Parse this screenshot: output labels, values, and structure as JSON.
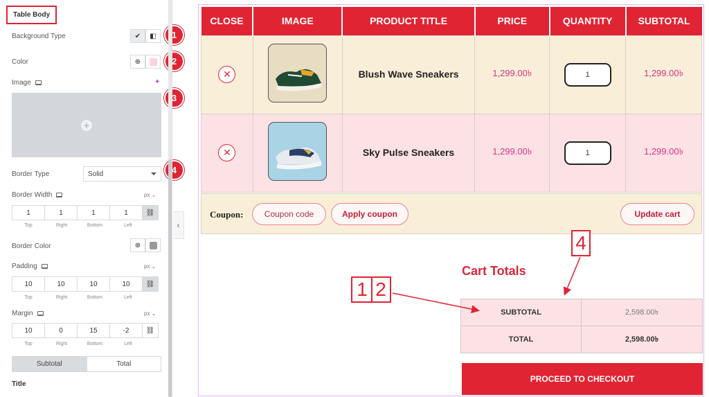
{
  "panel": {
    "section_title": "Table Body",
    "background_type_label": "Background Type",
    "color_label": "Color",
    "image_label": "Image",
    "border_type_label": "Border Type",
    "border_type_value": "Solid",
    "border_width_label": "Border Width",
    "border_color_label": "Border Color",
    "padding_label": "Padding",
    "margin_label": "Margin",
    "unit": "px",
    "border_width": {
      "top": "1",
      "right": "1",
      "bottom": "1",
      "left": "1"
    },
    "padding": {
      "top": "10",
      "right": "10",
      "bottom": "10",
      "left": "10"
    },
    "margin": {
      "top": "10",
      "right": "0",
      "bottom": "15",
      "left": "-2"
    },
    "dim_labels": {
      "top": "Top",
      "right": "Right",
      "bottom": "Bottom",
      "left": "Left"
    },
    "tabs": [
      "Subtotal",
      "Total"
    ],
    "title_label": "Title",
    "color_swatch": "#f6d5dc",
    "badges": [
      "1",
      "2",
      "3",
      "4"
    ]
  },
  "cart": {
    "headers": [
      "CLOSE",
      "IMAGE",
      "PRODUCT TITLE",
      "PRICE",
      "QUANTITY",
      "SUBTOTAL"
    ],
    "rows": [
      {
        "title": "Blush Wave Sneakers",
        "price": "1,299.00৳",
        "qty": "1",
        "subtotal": "1,299.00৳"
      },
      {
        "title": "Sky Pulse Sneakers",
        "price": "1,299.00৳",
        "qty": "1",
        "subtotal": "1,299.00৳"
      }
    ],
    "coupon_label": "Coupon:",
    "coupon_placeholder": "Coupon code",
    "apply_coupon": "Apply coupon",
    "update_cart": "Update cart"
  },
  "totals": {
    "title": "Cart Totals",
    "subtotal_label": "SUBTOTAL",
    "subtotal_value": "2,598.00৳",
    "total_label": "TOTAL",
    "total_value": "2,598.00৳",
    "checkout": "PROCEED TO CHECKOUT"
  },
  "callouts": {
    "left_a": "1",
    "left_b": "2",
    "right": "4"
  },
  "colors": {
    "accent": "#e02433",
    "row1_bg": "#f9efd9",
    "row2_bg": "#fde2e5",
    "price": "#d63384"
  }
}
